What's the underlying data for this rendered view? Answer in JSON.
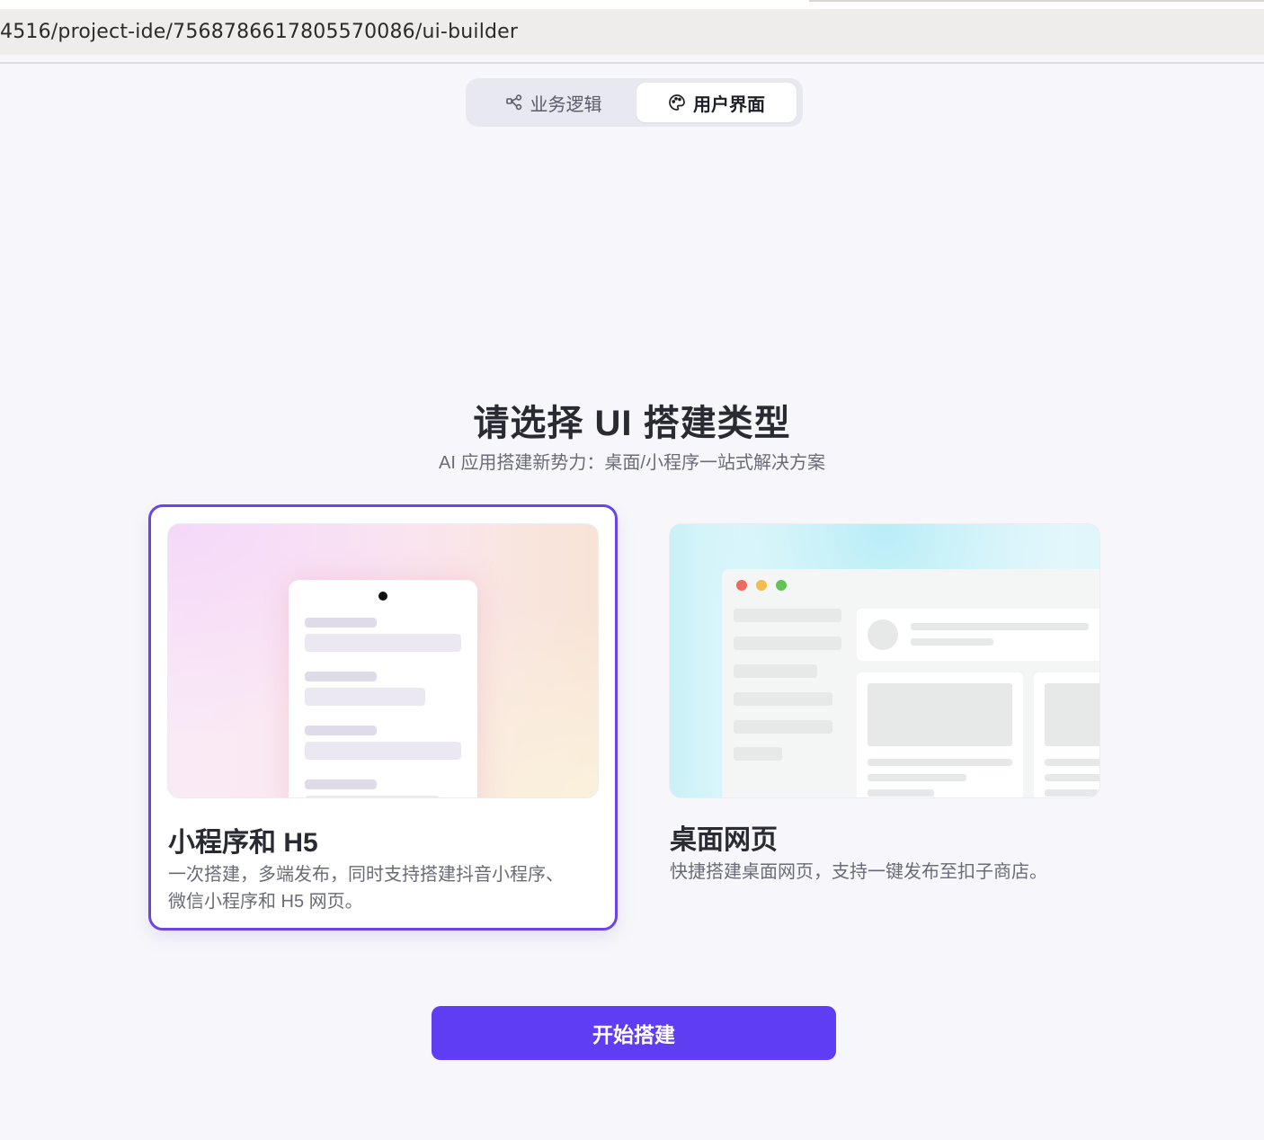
{
  "browser": {
    "url": "4516/project-ide/7568786617805570086/ui-builder"
  },
  "segment": {
    "tabs": [
      {
        "label": "业务逻辑",
        "icon": "workflow-icon",
        "active": false
      },
      {
        "label": "用户界面",
        "icon": "palette-icon",
        "active": true
      }
    ]
  },
  "main": {
    "title": "请选择 UI 搭建类型",
    "subtitle": "AI 应用搭建新势力：桌面/小程序一站式解决方案"
  },
  "cards": [
    {
      "title": "小程序和 H5",
      "description_line1": "一次搭建，多端发布，同时支持搭建抖音小程序、",
      "description_line2": "微信小程序和 H5 网页。",
      "selected": true
    },
    {
      "title": "桌面网页",
      "description_line1": "快捷搭建桌面网页，支持一键发布至扣子商店。",
      "selected": false
    }
  ],
  "actions": {
    "start_label": "开始搭建"
  },
  "colors": {
    "accent": "#5f3df2",
    "selected_border": "#6a44e6",
    "background": "#f7f7fb"
  }
}
